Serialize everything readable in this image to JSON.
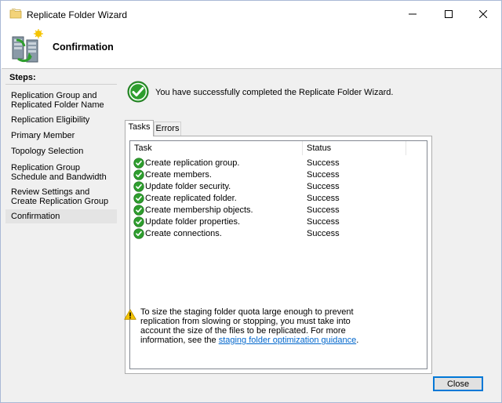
{
  "window": {
    "title": "Replicate Folder Wizard",
    "minimize_glyph": "—",
    "maximize_glyph": "☐",
    "close_glyph": "✕"
  },
  "header": {
    "heading": "Confirmation"
  },
  "steps": {
    "title": "Steps:",
    "items": [
      {
        "label": "Replication Group and Replicated Folder Name"
      },
      {
        "label": "Replication Eligibility"
      },
      {
        "label": "Primary Member"
      },
      {
        "label": "Topology Selection"
      },
      {
        "label": "Replication Group Schedule and Bandwidth"
      },
      {
        "label": "Review Settings and Create Replication Group"
      },
      {
        "label": "Confirmation"
      }
    ]
  },
  "main": {
    "success_message": "You have successfully completed the Replicate Folder Wizard.",
    "tabs": [
      {
        "label": "Tasks"
      },
      {
        "label": "Errors"
      }
    ],
    "columns": [
      "Task",
      "Status"
    ],
    "rows": [
      {
        "task": "Create replication group.",
        "status": "Success"
      },
      {
        "task": "Create members.",
        "status": "Success"
      },
      {
        "task": "Update folder security.",
        "status": "Success"
      },
      {
        "task": "Create replicated folder.",
        "status": "Success"
      },
      {
        "task": "Create membership objects.",
        "status": "Success"
      },
      {
        "task": "Update folder properties.",
        "status": "Success"
      },
      {
        "task": "Create connections.",
        "status": "Success"
      }
    ],
    "warning_text": "To size the staging folder quota large enough to prevent replication from slowing or stopping, you must take into account the size of the files to be replicated. For more information, see the",
    "warning_link": "staging folder optimization guidance",
    "warning_end": ".",
    "close_label": "Close"
  },
  "colors": {
    "accent": "#0078d7",
    "success_green": "#2e9e2e",
    "warning_yellow": "#f5c400",
    "link": "#0066cc"
  }
}
